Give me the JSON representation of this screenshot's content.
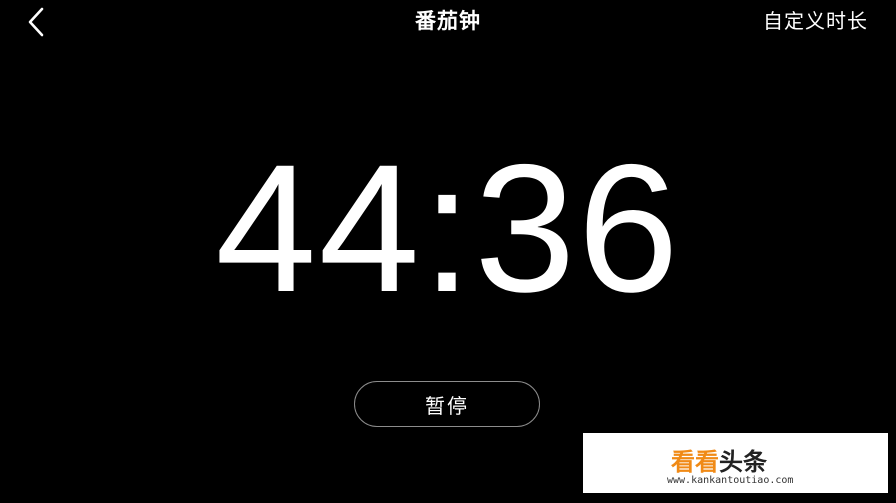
{
  "header": {
    "back_icon": "chevron-left-icon",
    "title": "番茄钟",
    "custom_duration_label": "自定义时长"
  },
  "timer": {
    "display": "44:36"
  },
  "controls": {
    "pause_label": "暂停"
  },
  "watermark": {
    "brand_part1": "看看",
    "brand_part2": "头条",
    "url": "www.kankantoutiao.com"
  },
  "colors": {
    "background": "#000000",
    "text": "#ffffff",
    "button_border": "#8c8c8c",
    "watermark_accent": "#f08a16"
  }
}
